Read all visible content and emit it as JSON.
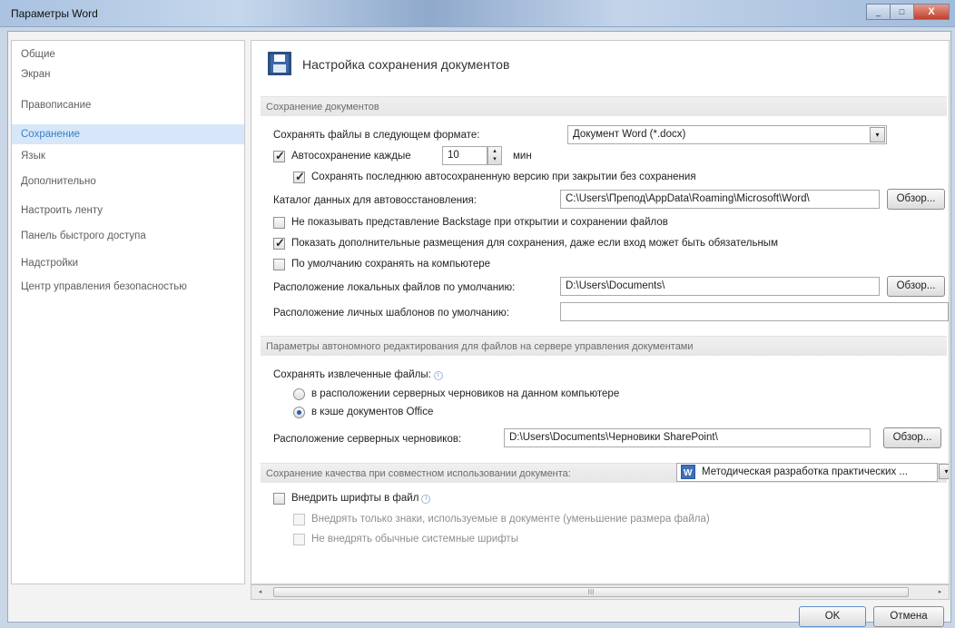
{
  "window": {
    "title": "Параметры Word",
    "controls": {
      "minimize": "_",
      "maximize": "□",
      "close": "X"
    }
  },
  "sidebar": {
    "items": [
      {
        "label": "Общие"
      },
      {
        "label": "Экран"
      },
      {
        "label": "Правописание"
      },
      {
        "label": "Сохранение",
        "active": true
      },
      {
        "label": "Язык"
      },
      {
        "label": "Дополнительно"
      },
      {
        "label": "Настроить ленту"
      },
      {
        "label": "Панель быстрого доступа"
      },
      {
        "label": "Надстройки"
      },
      {
        "label": "Центр управления безопасностью"
      }
    ]
  },
  "main": {
    "header_title": "Настройка сохранения документов",
    "save_section": {
      "title": "Сохранение документов",
      "format_label": "Сохранять файлы в следующем формате:",
      "format_value": "Документ Word (*.docx)",
      "autosave_label": "Автосохранение каждые",
      "autosave_checked": true,
      "autosave_minutes": "10",
      "autosave_unit": "мин",
      "keep_last_label": "Сохранять последнюю автосохраненную версию при закрытии без сохранения",
      "keep_last_checked": true,
      "autorecover_label": "Каталог данных для автовосстановления:",
      "autorecover_path": "C:\\Users\\Препод\\AppData\\Roaming\\Microsoft\\Word\\",
      "browse_label": "Обзор...",
      "no_backstage_label": "Не показывать представление Backstage при открытии и сохранении файлов",
      "no_backstage_checked": false,
      "show_additional_label": "Показать дополнительные размещения для сохранения, даже если вход может быть обязательным",
      "show_additional_checked": true,
      "save_to_computer_label": "По умолчанию сохранять на компьютере",
      "save_to_computer_checked": false,
      "local_files_label": "Расположение локальных файлов по умолчанию:",
      "local_files_path": "D:\\Users\\Documents\\",
      "templates_label": "Расположение личных шаблонов по умолчанию:",
      "templates_path": ""
    },
    "offline_section": {
      "title": "Параметры автономного редактирования для файлов на сервере управления документами",
      "save_checked_out_label": "Сохранять извлеченные файлы:",
      "radio_server_label": "в расположении серверных черновиков на данном компьютере",
      "radio_cache_label": "в кэше документов Office",
      "selected_radio": "cache",
      "drafts_label": "Расположение серверных черновиков:",
      "drafts_path": "D:\\Users\\Documents\\Черновики SharePoint\\"
    },
    "fidelity_section": {
      "title": "Сохранение качества при совместном использовании документа:",
      "document_value": "Методическая разработка практических ...",
      "embed_fonts_label": "Внедрить шрифты в файл",
      "embed_fonts_checked": false,
      "embed_used_only_label": "Внедрять только знаки, используемые в документе (уменьшение размера файла)",
      "no_common_fonts_label": "Не внедрять обычные системные шрифты"
    }
  },
  "footer": {
    "ok_label": "OK",
    "cancel_label": "Отмена",
    "scroll_left": "◂",
    "scroll_right": "▸",
    "scroll_grip": "III"
  },
  "icons": {
    "save_header": "floppy-disk-icon",
    "dropdown": "▾",
    "spin_up": "▴",
    "spin_down": "▾",
    "info": "i"
  }
}
